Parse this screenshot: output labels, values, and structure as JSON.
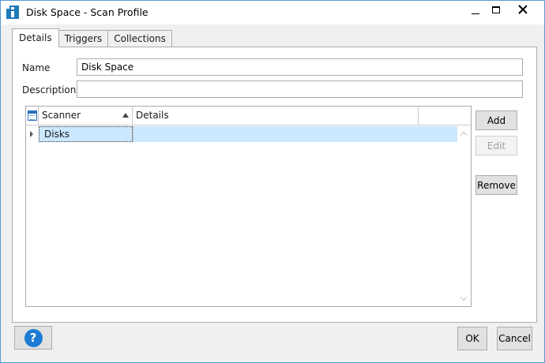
{
  "window": {
    "title": "Disk Space - Scan Profile",
    "controls": {
      "minimize": "minimize",
      "maximize": "maximize",
      "close": "close"
    }
  },
  "tabs": [
    {
      "label": "Details",
      "active": true
    },
    {
      "label": "Triggers",
      "active": false
    },
    {
      "label": "Collections",
      "active": false
    }
  ],
  "form": {
    "name_label": "Name",
    "name_value": "Disk Space",
    "description_label": "Description",
    "description_value": ""
  },
  "grid": {
    "columns": [
      "Scanner",
      "Details"
    ],
    "sort": {
      "column": "Scanner",
      "direction": "ascending"
    },
    "rows": [
      {
        "scanner": "Disks",
        "details": "",
        "selected": true,
        "expandable": true
      }
    ]
  },
  "side_buttons": {
    "add": "Add",
    "edit": "Edit",
    "remove": "Remove"
  },
  "footer": {
    "ok": "OK",
    "cancel": "Cancel"
  },
  "icons": {
    "app": "app-logo-icon",
    "help": "help-icon",
    "column_chooser": "calendar-icon",
    "sort": "sort-up-icon",
    "expand": "expand-icon"
  },
  "colors": {
    "accent": "#1e7bd3",
    "selection": "#cce8ff",
    "window_border": "#5a9bd5"
  }
}
